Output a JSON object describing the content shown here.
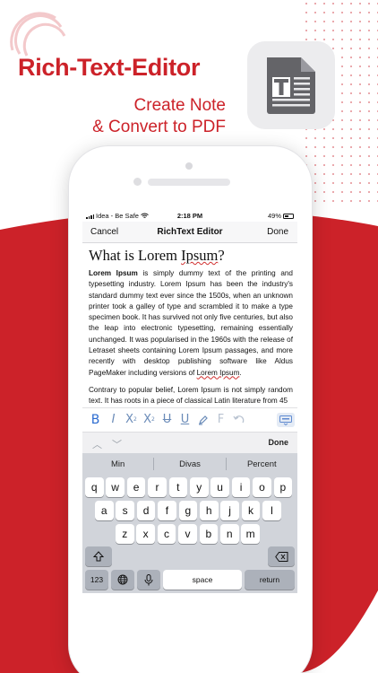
{
  "colors": {
    "brand_red": "#cc2229",
    "link_blue": "#2b6bd0",
    "keyboard_bg": "#d1d4da"
  },
  "promo": {
    "title": "Rich-Text-Editor",
    "subtitle_line1": "Create Note",
    "subtitle_line2": "& Convert to PDF",
    "app_icon": "document-T-icon"
  },
  "status_bar": {
    "carrier": "Idea - Be Safe",
    "time": "2:18 PM",
    "battery": "49%"
  },
  "nav": {
    "cancel": "Cancel",
    "title": "RichText Editor",
    "done": "Done"
  },
  "document": {
    "title_prefix": "What is Lorem ",
    "title_misspelled": "Ipsum",
    "title_suffix": "?",
    "p1_bold": "Lorem Ipsum",
    "p1_text": " is simply dummy text of the printing and typesetting industry. Lorem Ipsum has been the industry's standard dummy text ever since the 1500s, when an unknown printer took a galley of type and scrambled it to make a type specimen book. It has survived not only five centuries, but also the leap into electronic typesetting, remaining essentially unchanged. It was popularised in the 1960s with the release of Letraset sheets containing Lorem Ipsum passages, and more recently with desktop publishing software like Aldus PageMaker including versions of ",
    "p1_link": "Lorem Ipsum",
    "p1_end": ".",
    "p2_text": "Contrary to popular belief, Lorem Ipsum is not simply random text. It has roots in a piece of classical Latin literature from 45"
  },
  "format_toolbar": {
    "bold": "B",
    "italic": "I",
    "subscript": "X",
    "subscript_mark": "2",
    "superscript": "X",
    "superscript_mark": "2",
    "strikethrough": "U",
    "underline": "U",
    "highlight_icon": "highlighter-icon",
    "font": "F",
    "undo_icon": "undo-icon",
    "keyboard_icon": "keyboard-icon"
  },
  "accessory": {
    "done": "Done"
  },
  "keyboard": {
    "suggestions": [
      "Min",
      "Divas",
      "Percent"
    ],
    "row1": [
      "q",
      "w",
      "e",
      "r",
      "t",
      "y",
      "u",
      "i",
      "o",
      "p"
    ],
    "row2": [
      "a",
      "s",
      "d",
      "f",
      "g",
      "h",
      "j",
      "k",
      "l"
    ],
    "row3": [
      "z",
      "x",
      "c",
      "v",
      "b",
      "n",
      "m"
    ],
    "numbers": "123",
    "space": "space",
    "return": "return"
  }
}
